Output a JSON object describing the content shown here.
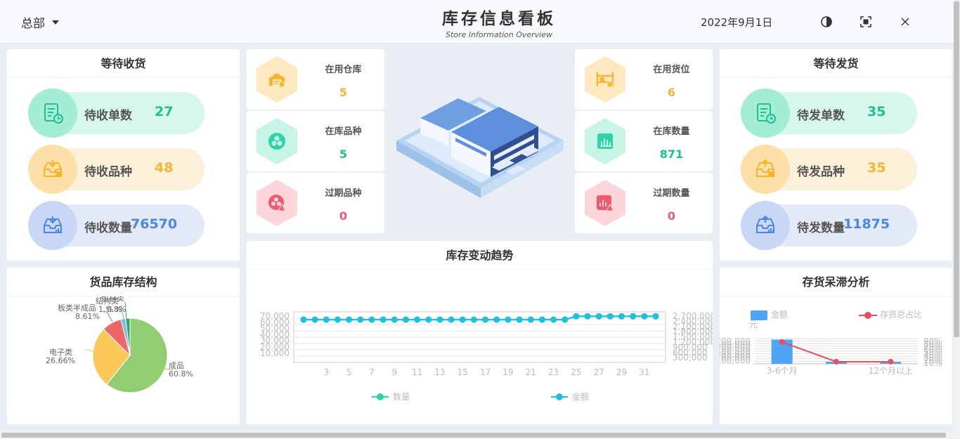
{
  "header": {
    "org": "总部",
    "title": "库存信息看板",
    "subtitle": "Store Information Overview",
    "date": "2022年9月1日"
  },
  "receiving": {
    "title": "等待收货",
    "items": [
      {
        "label": "待收单数",
        "value": "27"
      },
      {
        "label": "待收品种",
        "value": "48"
      },
      {
        "label": "待收数量",
        "value": "76570"
      }
    ]
  },
  "shipping": {
    "title": "等待发货",
    "items": [
      {
        "label": "待发单数",
        "value": "35"
      },
      {
        "label": "待发品种",
        "value": "35"
      },
      {
        "label": "待发数量",
        "value": "11875"
      }
    ]
  },
  "stats": {
    "left": [
      {
        "label": "在用仓库",
        "value": "5"
      },
      {
        "label": "在库品种",
        "value": "5"
      },
      {
        "label": "过期品种",
        "value": "0"
      }
    ],
    "right": [
      {
        "label": "在用货位",
        "value": "6"
      },
      {
        "label": "在库数量",
        "value": "871"
      },
      {
        "label": "过期数量",
        "value": "0"
      }
    ]
  },
  "colors": {
    "green": "#1fbf8f",
    "orange": "#f7b52c",
    "blue": "#4a86e8",
    "red": "#f05a6e",
    "cyan": "#1ec0de"
  },
  "pie": {
    "title": "货品库存结构",
    "chart_data": {
      "type": "pie",
      "slices": [
        {
          "name": "成品",
          "value": 60.8,
          "label": "60.8%",
          "color": "#93cd72"
        },
        {
          "name": "电子类",
          "value": 26.66,
          "label": "26.66%",
          "color": "#fac858"
        },
        {
          "name": "板类半成品",
          "value": 8.61,
          "label": "8.61%",
          "color": "#ee6666"
        },
        {
          "name": "结构类",
          "value": 2.0,
          "label": "",
          "color": "#73c0de"
        },
        {
          "name": "包材类",
          "value": 1.93,
          "label": "",
          "color": "#3ba272"
        }
      ],
      "overlap_labels": [
        "结构类",
        "包材类",
        "1.%",
        "0.%",
        "8%"
      ]
    }
  },
  "trend": {
    "title": "库存变动趋势",
    "chart_data": {
      "type": "line",
      "x": [
        1,
        2,
        3,
        4,
        5,
        6,
        7,
        8,
        9,
        10,
        11,
        12,
        13,
        14,
        15,
        16,
        17,
        18,
        19,
        20,
        21,
        22,
        23,
        24,
        25,
        26,
        27,
        28,
        29,
        30,
        31,
        32
      ],
      "x_tick_labels": [
        "3",
        "5",
        "7",
        "9",
        "11",
        "13",
        "15",
        "17",
        "19",
        "21",
        "23",
        "25",
        "27",
        "29",
        "31"
      ],
      "y_left_ticks": [
        "70,000",
        "60,000",
        "50,000",
        "40,000",
        "30,000",
        "20,000",
        "10,000"
      ],
      "y_right_ticks": [
        "2,700,000",
        "2,400,000",
        "2,100,000",
        "1,800,000",
        "1,500,000",
        "1,200,000",
        "900,000",
        "600,000",
        "300,000"
      ],
      "y_left_range": [
        0,
        75000
      ],
      "y_right_range": [
        0,
        2850000
      ],
      "series": [
        {
          "name": "数量",
          "color": "#2ed3a7",
          "values": [
            63500,
            63500,
            63500,
            63500,
            63500,
            63500,
            63500,
            63500,
            63500,
            63500,
            63500,
            63500,
            63500,
            63500,
            63500,
            63500,
            63500,
            63500,
            63500,
            63500,
            63500,
            63500,
            63500,
            63500,
            68400,
            68400,
            68400,
            68400,
            68400,
            68400,
            68400,
            68400
          ]
        },
        {
          "name": "金额",
          "color": "#1ec0de",
          "values": [
            2410000,
            2410000,
            2410000,
            2410000,
            2410000,
            2410000,
            2410000,
            2410000,
            2410000,
            2410000,
            2410000,
            2410000,
            2410000,
            2410000,
            2410000,
            2410000,
            2410000,
            2410000,
            2410000,
            2410000,
            2410000,
            2410000,
            2410000,
            2410000,
            2600000,
            2600000,
            2600000,
            2600000,
            2600000,
            2600000,
            2600000,
            2600000
          ]
        }
      ]
    }
  },
  "stagnant": {
    "title": "存货呆滞分析",
    "chart_data": {
      "type": "bar",
      "legend": [
        "金额",
        "存货总占比"
      ],
      "unit": "元",
      "categories": [
        "3-6个月",
        "",
        "12个月以上"
      ],
      "y_left_ticks": [
        "700,000",
        "600,000",
        "500,000",
        "400,000",
        "300,000",
        "200,000",
        "100,000"
      ],
      "y_right_ticks": [
        "90%",
        "80%",
        "70%",
        "60%",
        "50%",
        "40%",
        "30%",
        "20%",
        "10%"
      ],
      "y_left_range": [
        0,
        750000
      ],
      "y_right_range": [
        0,
        95
      ],
      "series": [
        {
          "name": "金额",
          "color": "#4da6f5",
          "values": [
            720000,
            60000,
            60000
          ]
        },
        {
          "name": "存货总占比",
          "color": "#ee4b5b",
          "values": [
            82,
            8,
            8
          ]
        }
      ]
    }
  }
}
